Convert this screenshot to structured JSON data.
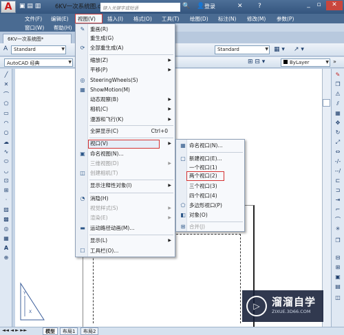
{
  "titlebar": {
    "logo": "A",
    "title": "6KV一次系统图.dwg",
    "search_placeholder": "键入关键字或短语",
    "login": "登录",
    "min": "_",
    "restore": "▫",
    "close": "✕"
  },
  "menubar": {
    "items": [
      "文件(F)",
      "编辑(E)",
      "视图(V)",
      "插入(I)",
      "格式(O)",
      "工具(T)",
      "绘图(D)",
      "标注(N)",
      "修改(M)",
      "参数(P)"
    ],
    "row2": [
      "窗口(W)",
      "帮助(H)"
    ]
  },
  "doc_tab": "6KV一次系统图*",
  "toolbar1": {
    "style1": "Standard",
    "style2": "Standard"
  },
  "toolbar2": {
    "workspace": "AutoCAD 经典",
    "layer": "ByLayer"
  },
  "view_menu": {
    "items": [
      {
        "label": "重画(R)",
        "icon": "redraw-icon",
        "glyph": "✎"
      },
      {
        "label": "重生成(G)",
        "icon": "",
        "glyph": ""
      },
      {
        "label": "全部重生成(A)",
        "icon": "regen-all-icon",
        "glyph": "⟳"
      },
      {
        "label": "缩放(Z)",
        "arrow": true
      },
      {
        "label": "平移(P)",
        "arrow": true
      },
      {
        "label": "SteeringWheels(S)",
        "icon": "steering-wheel-icon",
        "glyph": "◎"
      },
      {
        "label": "ShowMotion(M)",
        "icon": "showmotion-icon",
        "glyph": "▦"
      },
      {
        "label": "动态观察(B)",
        "arrow": true
      },
      {
        "label": "相机(C)",
        "arrow": true
      },
      {
        "label": "漫游和飞行(K)",
        "arrow": true
      },
      {
        "label": "全屏显示(C)",
        "shortcut": "Ctrl+0"
      },
      {
        "label": "视口(V)",
        "arrow": true,
        "highlight": true
      },
      {
        "label": "命名视图(N)...",
        "icon": "named-view-icon",
        "glyph": "▣"
      },
      {
        "label": "三维视图(D)",
        "arrow": true,
        "disabled": true
      },
      {
        "label": "创建相机(T)",
        "icon": "camera-icon",
        "glyph": "◫",
        "disabled": true
      },
      {
        "label": "显示注释性对象(I)",
        "arrow": true
      },
      {
        "label": "消隐(H)",
        "icon": "hide-icon",
        "glyph": "◔"
      },
      {
        "label": "视觉样式(S)",
        "arrow": true,
        "disabled": true
      },
      {
        "label": "渲染(E)",
        "arrow": true,
        "disabled": true
      },
      {
        "label": "运动路径动画(M)...",
        "icon": "motion-path-icon",
        "glyph": "▬"
      },
      {
        "label": "显示(L)",
        "arrow": true
      },
      {
        "label": "工具栏(O)...",
        "icon": "toolbar-icon",
        "glyph": "☐"
      }
    ]
  },
  "viewports_menu": {
    "items": [
      {
        "label": "命名视口(N)...",
        "icon": "named-viewport-icon",
        "glyph": "▦"
      },
      {
        "label": "新建视口(E)...",
        "icon": "new-viewport-icon",
        "glyph": "▢"
      },
      {
        "label": "一个视口(1)"
      },
      {
        "label": "两个视口(2)",
        "highlight": true
      },
      {
        "label": "三个视口(3)"
      },
      {
        "label": "四个视口(4)"
      },
      {
        "label": "多边形视口(P)",
        "icon": "polygon-viewport-icon",
        "glyph": "⬠"
      },
      {
        "label": "对象(O)",
        "icon": "object-viewport-icon",
        "glyph": "◧"
      },
      {
        "label": "合并(J)",
        "icon": "join-icon",
        "glyph": "⊞",
        "disabled": true
      }
    ]
  },
  "status_tabs": [
    "模型",
    "布局1",
    "布局2"
  ],
  "status_nav": "◄◄ ◄ ► ►►",
  "watermark": {
    "logo": "▷",
    "title": "溜溜自学",
    "url": "ZIXUE.3D66.COM"
  },
  "colors": {
    "title_bg": "#34557e",
    "highlight_border": "#d43030",
    "menu_bg": "#f7f9fc"
  }
}
